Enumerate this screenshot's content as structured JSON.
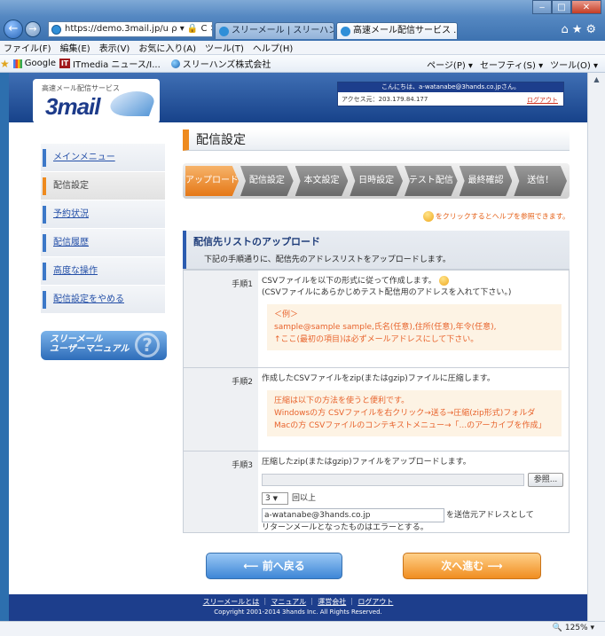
{
  "browser": {
    "address": "https://demo.3mail.jp/u",
    "address_icons": "ρ ▾ 🔒 C ✕",
    "tabs": [
      "スリーメール | スリーハンズ...",
      "高速メール配信サービス ... ×"
    ],
    "window_controls": [
      "‒",
      "□",
      "✕"
    ],
    "menu": [
      "ファイル(F)",
      "編集(E)",
      "表示(V)",
      "お気に入り(A)",
      "ツール(T)",
      "ヘルプ(H)"
    ],
    "favorites": [
      "Google",
      "ITmedia ニュース/I...",
      "スリーハンズ株式会社"
    ],
    "commands": [
      "ページ(P) ▾",
      "セーフティ(S) ▾",
      "ツール(O) ▾"
    ],
    "zoom": "125%"
  },
  "header": {
    "logo_sub": "高速メール配信サービス",
    "logo": "3mail",
    "greeting": "こんにちは、a-watanabe@3hands.co.jpさん。",
    "access": "アクセス元：203.179.84.177",
    "logout": "ログアウト"
  },
  "sidebar": {
    "items": [
      "メインメニュー",
      "配信設定",
      "予約状況",
      "配信履歴",
      "高度な操作",
      "配信設定をやめる"
    ],
    "manual_line1": "スリーメール",
    "manual_line2": "ユーザーマニュアル",
    "manual_q": "?"
  },
  "main": {
    "title": "配信設定",
    "steps": [
      "アップロード",
      "配信設定",
      "本文設定",
      "日時設定",
      "テスト配信",
      "最終確認",
      "送信！"
    ],
    "help_note": "をクリックするとヘルプを参照できます。",
    "section_title": "配信先リストのアップロード",
    "section_desc": "下記の手順通りに、配信先のアドレスリストをアップロードします。",
    "step1_label": "手順1",
    "step1_line1": "CSVファイルを以下の形式に従って作成します。",
    "step1_line2": "(CSVファイルにあらかじめテスト配信用のアドレスを入れて下さい。)",
    "example_title": "＜例＞",
    "example_line1": "sample@sample sample,氏名(任意),住所(任意),年令(任意),",
    "example_line2": "↑ここ(最初の項目)は必ずメールアドレスにして下さい。",
    "step2_label": "手順2",
    "step2_line1": "作成したCSVファイルをzip(またはgzip)ファイルに圧縮します。",
    "zip_line1": "圧縮は以下の方法を使うと便利です。",
    "zip_line2": "Windowsの方  CSVファイルを右クリック→送る→圧縮(zip形式)フォルダ",
    "zip_line3": "Macの方  CSVファイルのコンテキストメニュー→「...のアーカイブを作成」",
    "step3_label": "手順3",
    "step3_line1": "圧縮したzip(またはgzip)ファイルをアップロードします。",
    "browse": "参照...",
    "retry_value": "3",
    "retry_suffix": "回以上",
    "email_value": "a-watanabe@3hands.co.jp",
    "email_suffix": "を送信元アドレスとして",
    "error_line": "リターンメールとなったものはエラーとする。",
    "back_btn": "前へ戻る",
    "next_btn": "次へ進む"
  },
  "footer": {
    "links": [
      "スリーメールとは",
      "マニュアル",
      "運営会社",
      "ログアウト"
    ],
    "copyright": "Copyright 2001-2014 3hands Inc. All Rights Reserved."
  },
  "colors": {
    "accent_orange": "#ee8a1e",
    "navy": "#1d3e8c",
    "link_blue": "#2550a8"
  }
}
